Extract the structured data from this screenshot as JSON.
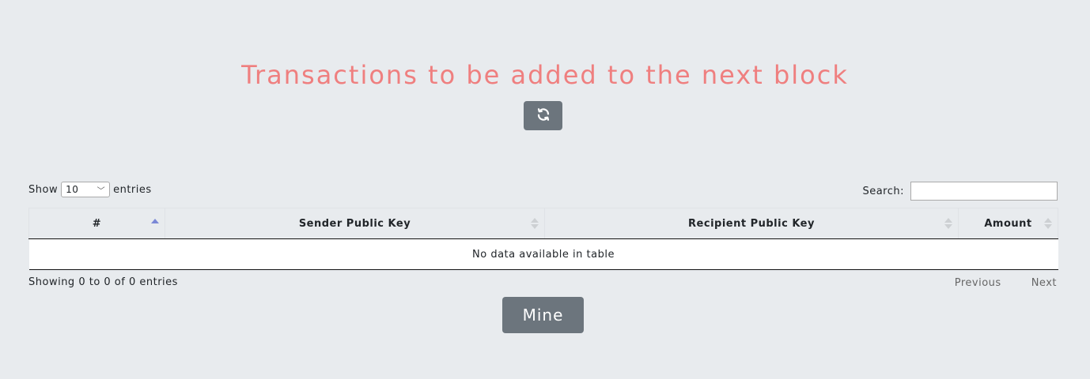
{
  "header": {
    "title": "Transactions to be added to the next block"
  },
  "refresh_button": {
    "icon": "refresh-icon"
  },
  "table_controls": {
    "show_label": "Show",
    "length_value": "10",
    "entries_label": "entries",
    "search_label": "Search:",
    "search_value": ""
  },
  "table": {
    "columns": [
      "#",
      "Sender Public Key",
      "Recipient Public Key",
      "Amount"
    ],
    "empty_message": "No data available in table"
  },
  "footer": {
    "info": "Showing 0 to 0 of 0 entries",
    "previous": "Previous",
    "next": "Next"
  },
  "mine_button": {
    "label": "Mine"
  },
  "colors": {
    "title": "#ef7f7f",
    "button_bg": "#6c757d",
    "page_bg": "#e8ebee",
    "sort_active": "#7b88d6"
  }
}
